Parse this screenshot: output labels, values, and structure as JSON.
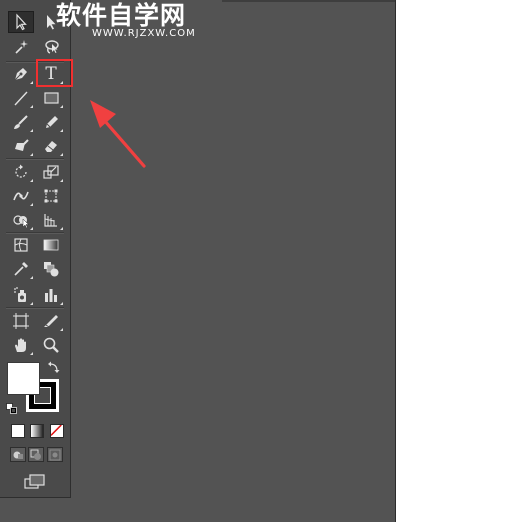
{
  "watermark": {
    "title": "软件自学网",
    "url": "WWW.RJZXW.COM"
  },
  "toolbar": {
    "tools": [
      {
        "id": "selection",
        "icon": "selection-arrow-icon",
        "selected": true
      },
      {
        "id": "direct-selection",
        "icon": "direct-selection-icon"
      },
      {
        "id": "magic-wand",
        "icon": "magic-wand-icon"
      },
      {
        "id": "lasso",
        "icon": "lasso-icon"
      },
      {
        "id": "pen",
        "icon": "pen-icon"
      },
      {
        "id": "type",
        "icon": "type-icon",
        "glyph": "T",
        "highlighted": true
      },
      {
        "id": "line-segment",
        "icon": "line-segment-icon"
      },
      {
        "id": "rectangle",
        "icon": "rectangle-icon"
      },
      {
        "id": "paintbrush",
        "icon": "paintbrush-icon"
      },
      {
        "id": "pencil",
        "icon": "pencil-icon"
      },
      {
        "id": "blob-brush",
        "icon": "blob-brush-icon"
      },
      {
        "id": "eraser",
        "icon": "eraser-icon"
      },
      {
        "id": "rotate",
        "icon": "rotate-icon"
      },
      {
        "id": "scale",
        "icon": "scale-icon"
      },
      {
        "id": "width",
        "icon": "width-icon"
      },
      {
        "id": "free-transform",
        "icon": "free-transform-icon"
      },
      {
        "id": "shape-builder",
        "icon": "shape-builder-icon"
      },
      {
        "id": "perspective-grid",
        "icon": "perspective-grid-icon"
      },
      {
        "id": "mesh",
        "icon": "mesh-icon"
      },
      {
        "id": "gradient",
        "icon": "gradient-icon"
      },
      {
        "id": "eyedropper",
        "icon": "eyedropper-icon"
      },
      {
        "id": "blend",
        "icon": "blend-icon"
      },
      {
        "id": "symbol-sprayer",
        "icon": "symbol-sprayer-icon"
      },
      {
        "id": "column-graph",
        "icon": "column-graph-icon"
      },
      {
        "id": "artboard",
        "icon": "artboard-icon"
      },
      {
        "id": "slice",
        "icon": "slice-icon"
      },
      {
        "id": "hand",
        "icon": "hand-icon"
      },
      {
        "id": "zoom",
        "icon": "zoom-icon"
      }
    ],
    "colors": {
      "fill": "#ffffff",
      "stroke": "#000000",
      "highlight_border": "#f03030",
      "arrow": "#f04040",
      "panel": "#4a4a4a",
      "canvas": "#535353",
      "artboard": "#ffffff"
    },
    "color_modes": [
      {
        "id": "color",
        "icon": "solid-color-icon"
      },
      {
        "id": "gradient",
        "icon": "gradient-swatch-icon"
      },
      {
        "id": "none",
        "icon": "none-swatch-icon"
      }
    ],
    "draw_modes": [
      {
        "id": "draw-normal",
        "icon": "draw-normal-icon"
      },
      {
        "id": "draw-behind",
        "icon": "draw-behind-icon"
      },
      {
        "id": "draw-inside",
        "icon": "draw-inside-icon"
      }
    ],
    "screen_mode": {
      "icon": "screen-mode-icon"
    }
  }
}
